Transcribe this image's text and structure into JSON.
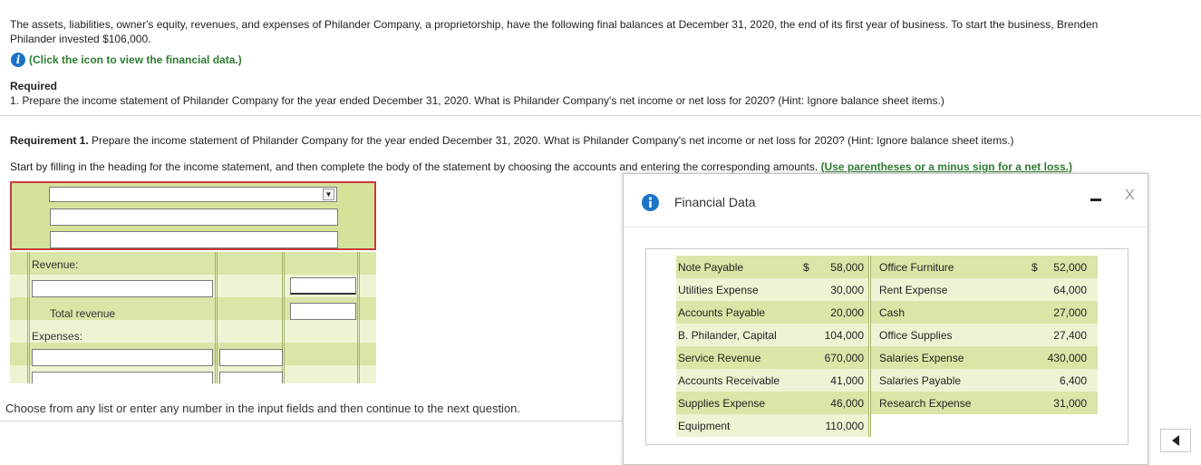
{
  "intro": {
    "line1": "The assets, liabilities, owner's equity, revenues, and expenses of Philander Company, a proprietorship, have the following final balances at December 31, 2020, the end of its first year of business. To start the business, Brenden",
    "line2": "Philander invested $106,000.",
    "info_link": "(Click the icon to view the financial data.)"
  },
  "required": {
    "title": "Required",
    "item": "1. Prepare the income statement of Philander Company for the year ended December 31, 2020. What is Philander Company's net income or net loss for 2020? (Hint: Ignore balance sheet items.)"
  },
  "requirement1": {
    "bold": "Requirement 1.",
    "text": " Prepare the income statement of Philander Company for the year ended December 31, 2020. What is Philander Company's net income or net loss for 2020? (Hint: Ignore balance sheet items.)"
  },
  "instructions": {
    "text": "Start by filling in the heading for the income statement, and then complete the body of the statement by choosing the accounts and entering the corresponding amounts. ",
    "green": "(Use parentheses or a minus sign for a net loss.)"
  },
  "worksheet": {
    "revenue_label": "Revenue:",
    "total_revenue_label": "Total revenue",
    "expenses_label": "Expenses:"
  },
  "footer": "Choose from any list or enter any number in the input fields and then continue to the next question.",
  "popup": {
    "title": "Financial Data",
    "close": "X",
    "rows": [
      {
        "a1": "Note Payable",
        "cur1": "$",
        "v1": "58,000",
        "a2": "Office Furniture",
        "cur2": "$",
        "v2": "52,000"
      },
      {
        "a1": "Utilities Expense",
        "cur1": "",
        "v1": "30,000",
        "a2": "Rent Expense",
        "cur2": "",
        "v2": "64,000"
      },
      {
        "a1": "Accounts Payable",
        "cur1": "",
        "v1": "20,000",
        "a2": "Cash",
        "cur2": "",
        "v2": "27,000"
      },
      {
        "a1": "B. Philander, Capital",
        "cur1": "",
        "v1": "104,000",
        "a2": "Office Supplies",
        "cur2": "",
        "v2": "27,400"
      },
      {
        "a1": "Service Revenue",
        "cur1": "",
        "v1": "670,000",
        "a2": "Salaries Expense",
        "cur2": "",
        "v2": "430,000"
      },
      {
        "a1": "Accounts Receivable",
        "cur1": "",
        "v1": "41,000",
        "a2": "Salaries Payable",
        "cur2": "",
        "v2": "6,400"
      },
      {
        "a1": "Supplies Expense",
        "cur1": "",
        "v1": "46,000",
        "a2": "Research Expense",
        "cur2": "",
        "v2": "31,000"
      },
      {
        "a1": "Equipment",
        "cur1": "",
        "v1": "110,000",
        "a2": "",
        "cur2": "",
        "v2": ""
      }
    ]
  }
}
